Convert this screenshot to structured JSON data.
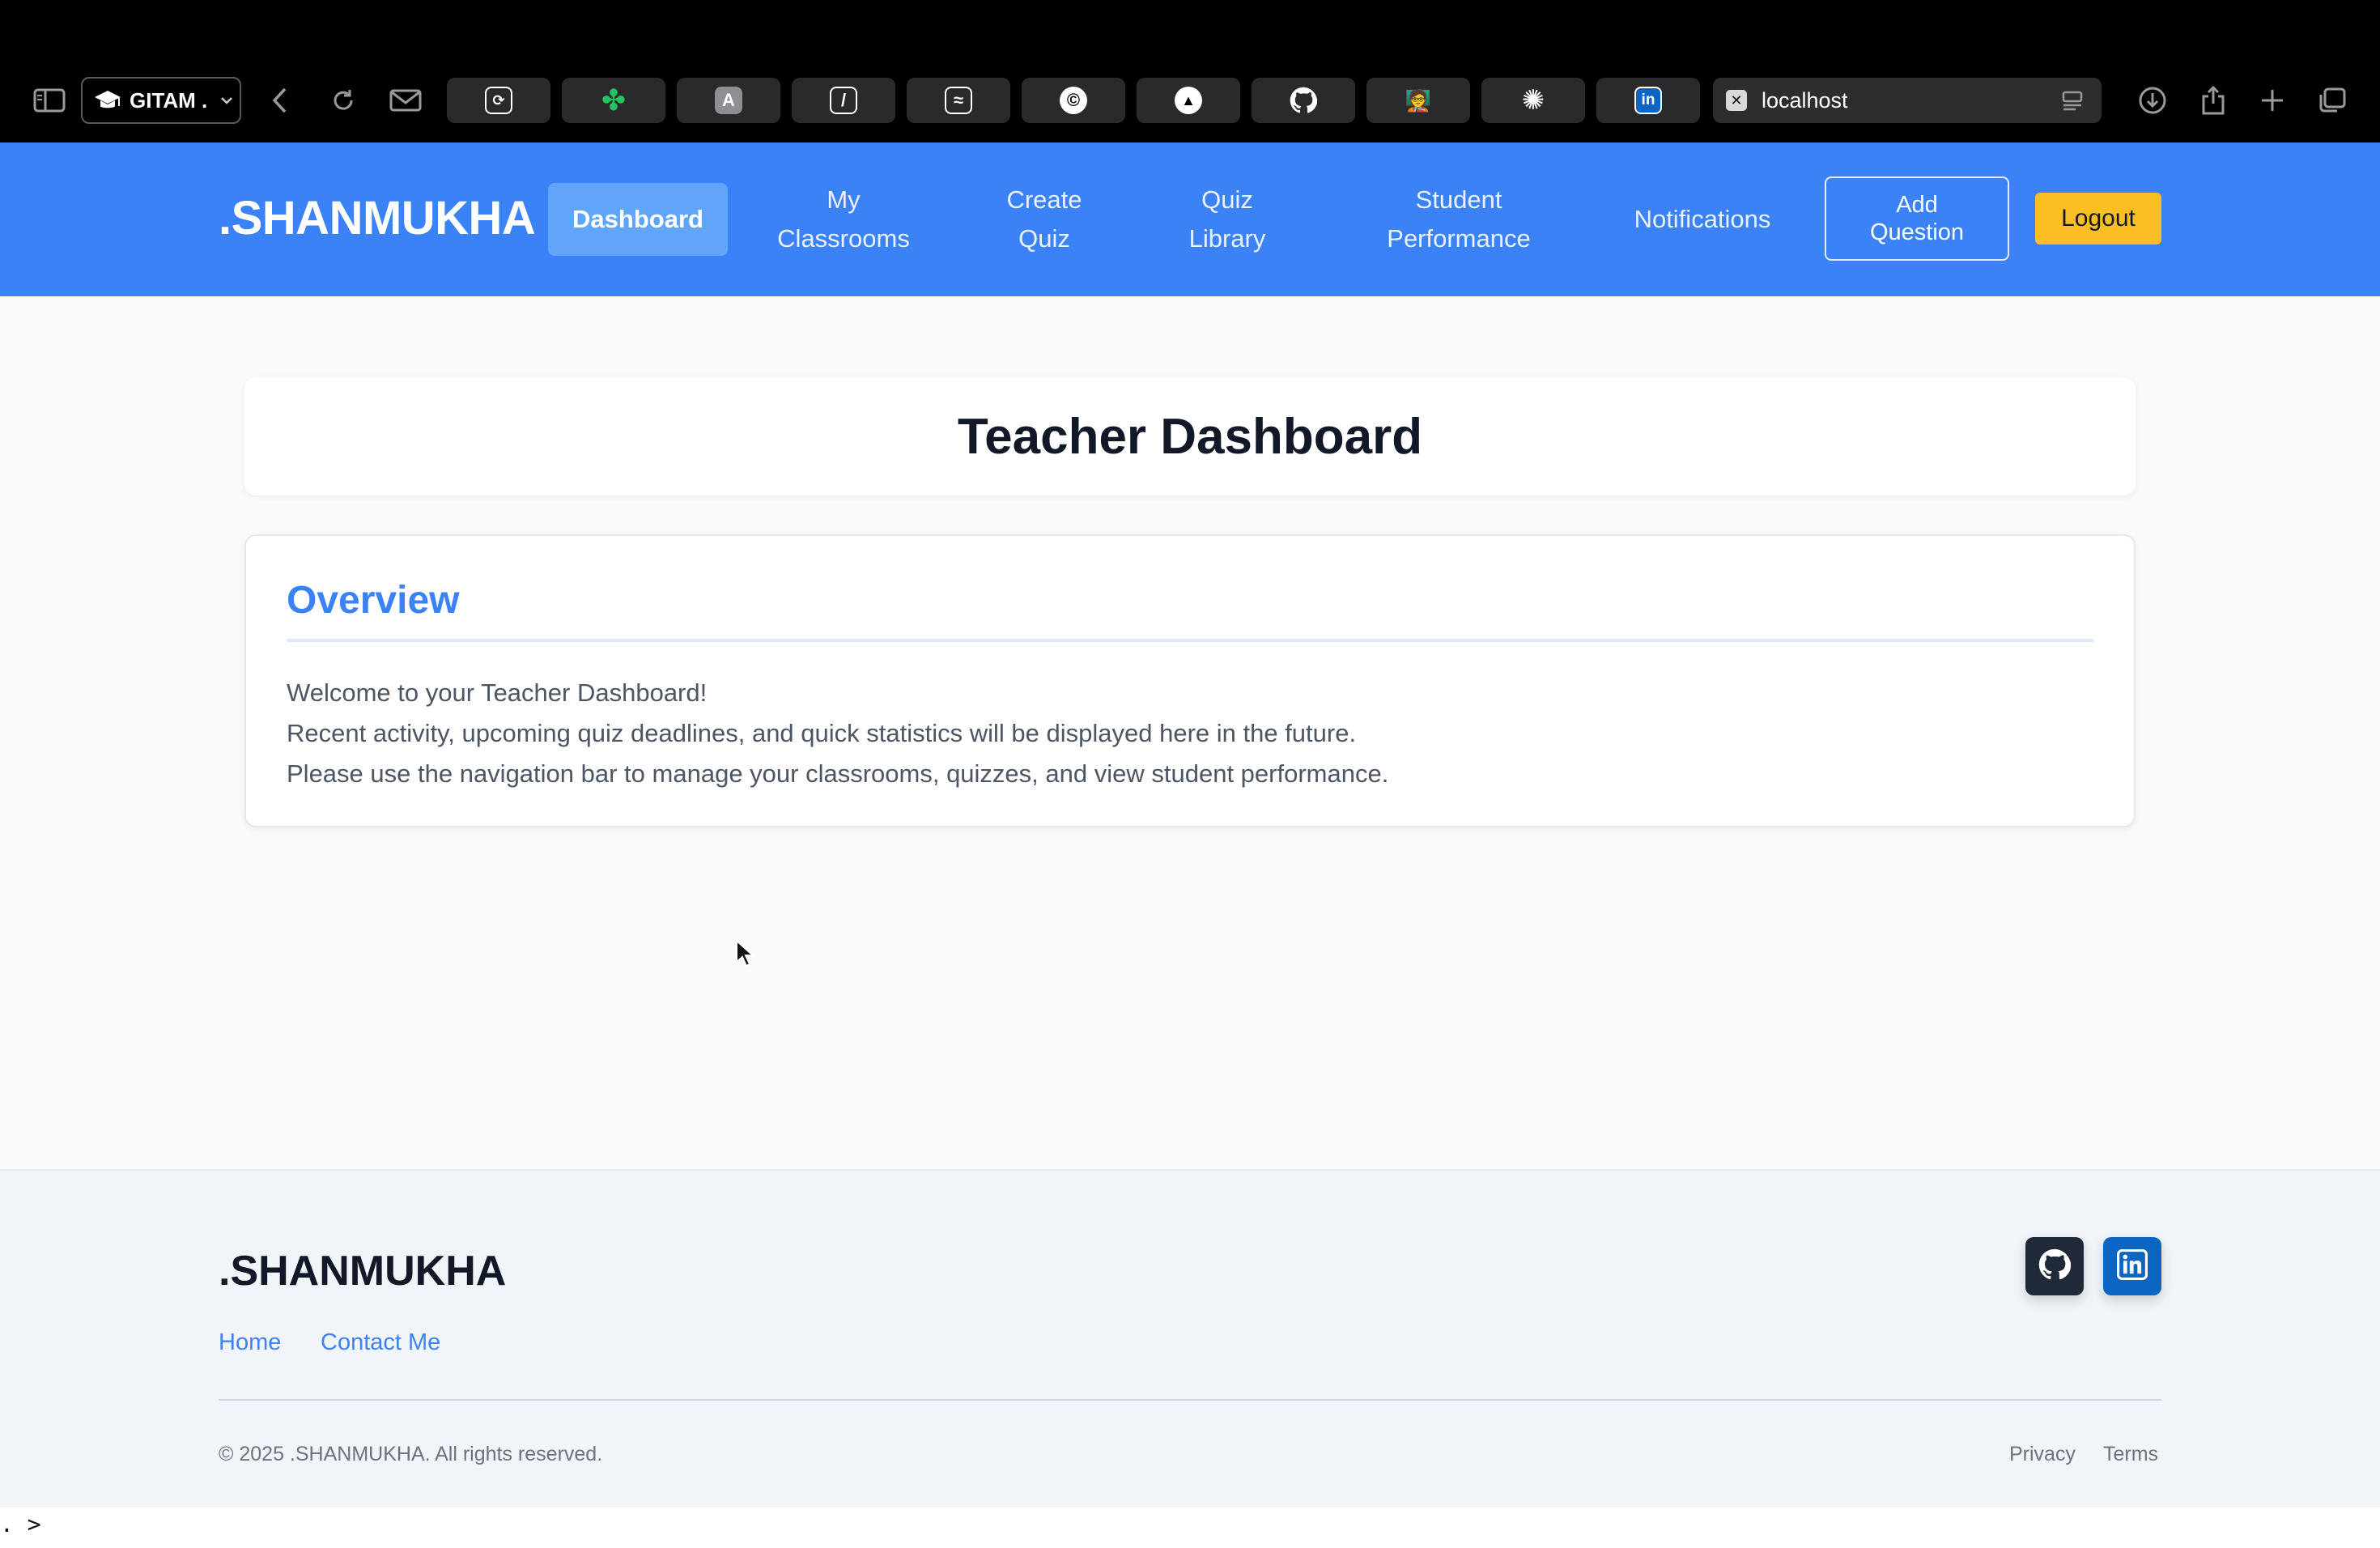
{
  "browser": {
    "profile_label": "GITAM .",
    "address": "localhost"
  },
  "navbar": {
    "brand": ".SHANMUKHA",
    "active": "Dashboard",
    "items": [
      {
        "label": "My\nClassrooms"
      },
      {
        "label": "Create\nQuiz"
      },
      {
        "label": "Quiz\nLibrary"
      },
      {
        "label": "Student\nPerformance"
      },
      {
        "label": "Notifications"
      }
    ],
    "add_question": "Add\nQuestion",
    "logout": "Logout"
  },
  "main": {
    "title": "Teacher Dashboard",
    "overview": {
      "heading": "Overview",
      "lines": [
        "Welcome to your Teacher Dashboard!",
        "Recent activity, upcoming quiz deadlines, and quick statistics will be displayed here in the future.",
        "Please use the navigation bar to manage your classrooms, quizzes, and view student performance."
      ]
    }
  },
  "footer": {
    "brand": ".SHANMUKHA",
    "links": [
      "Home",
      "Contact Me"
    ],
    "copyright": "© 2025 .SHANMUKHA. All rights reserved.",
    "legal": [
      "Privacy",
      "Terms"
    ],
    "social": [
      "github-icon",
      "linkedin-icon"
    ]
  },
  "terminal": {
    "prompt": ". >"
  },
  "colors": {
    "primary": "#3b82f6",
    "primary_light": "#60a5fa",
    "accent": "#fbbf24",
    "linkedin": "#0a66c2",
    "github": "#1f2937"
  }
}
